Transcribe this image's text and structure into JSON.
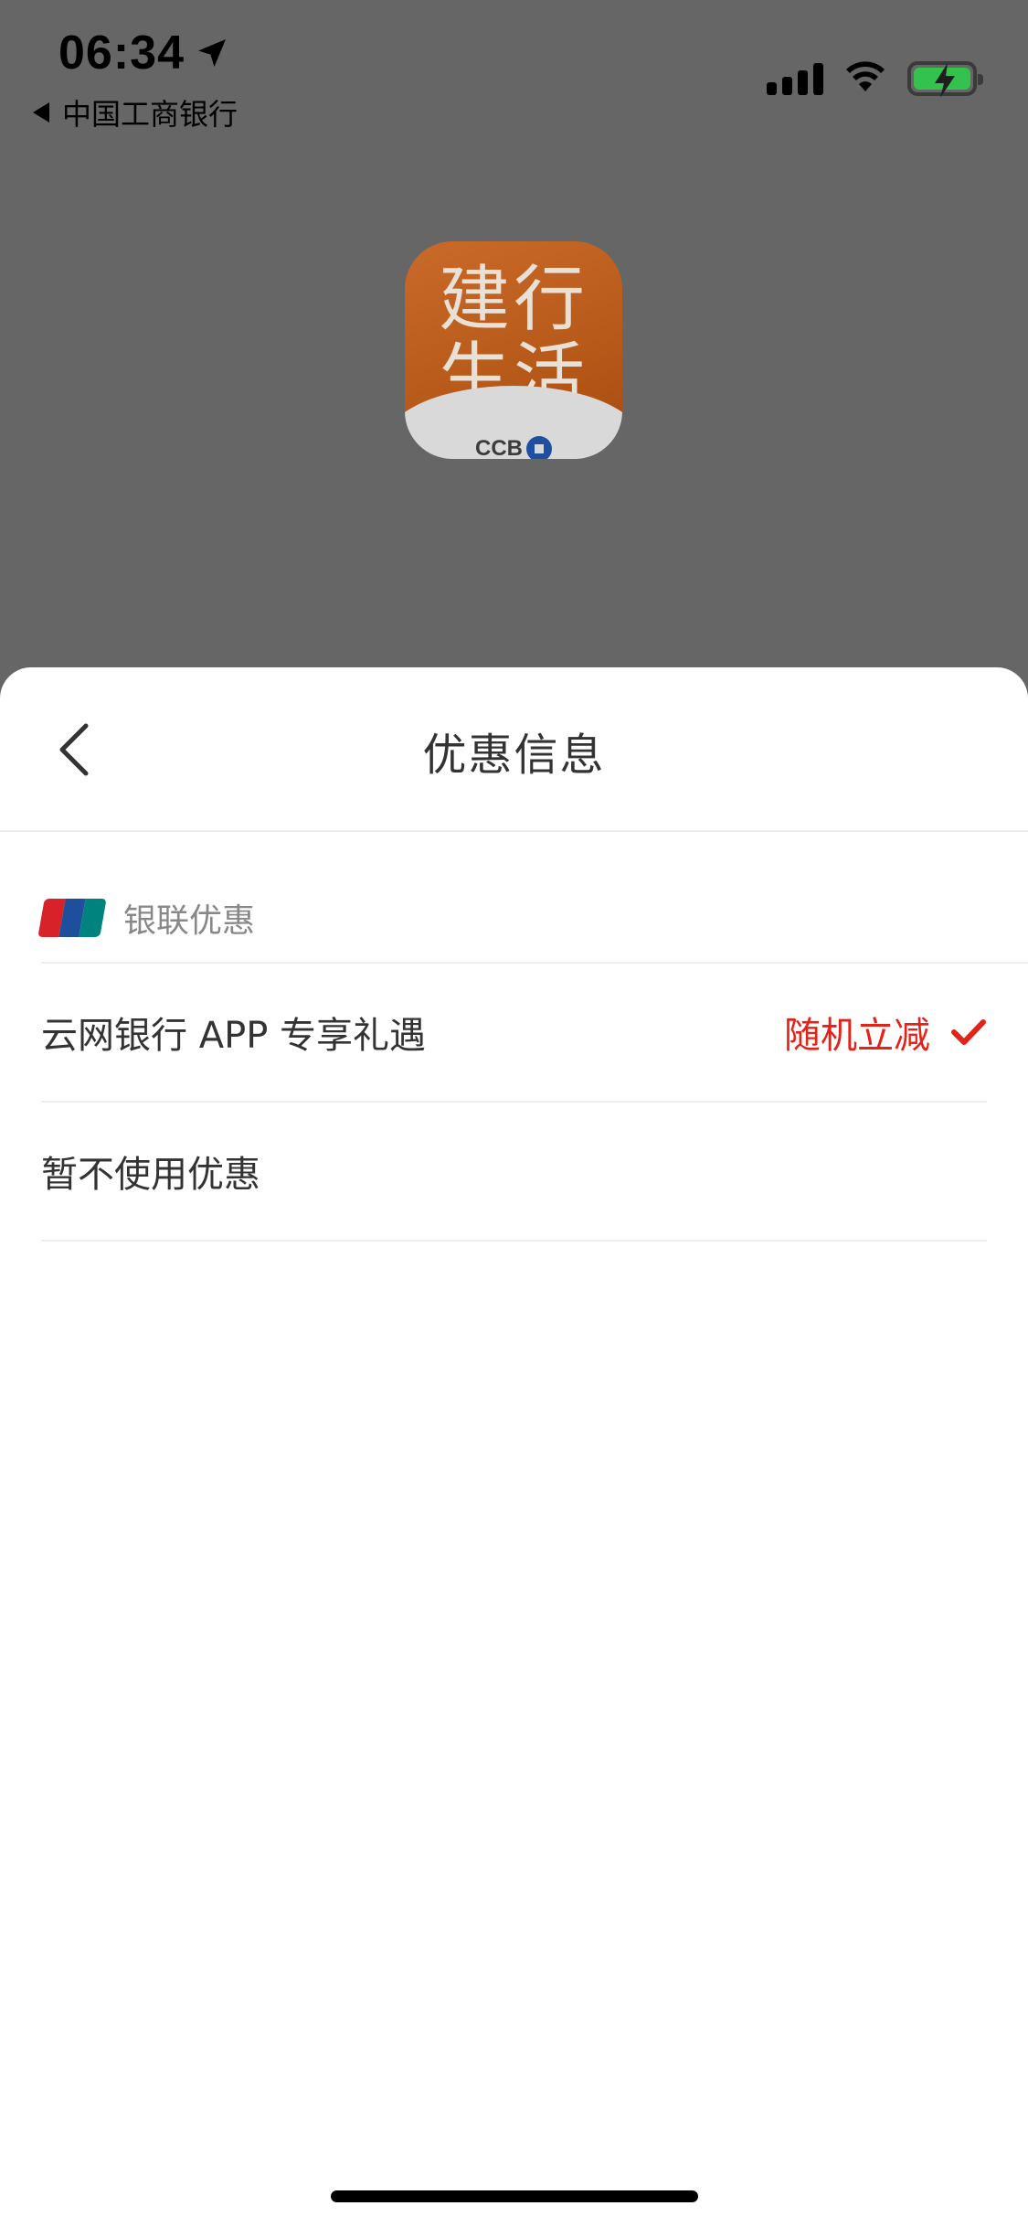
{
  "status_bar": {
    "time": "06:34",
    "back_app_label": "中国工商银行",
    "battery_color": "#33c24d"
  },
  "app_icon": {
    "line1": "建行",
    "line2": "生活",
    "brand": "CCB"
  },
  "sheet": {
    "title": "优惠信息",
    "back_icon": "chevron-left-icon",
    "section": {
      "icon": "unionpay-logo",
      "label": "银联优惠"
    },
    "options": [
      {
        "label": "云网银行 APP 专享礼遇",
        "value": "随机立减",
        "selected": true
      },
      {
        "label": "暂不使用优惠",
        "value": "",
        "selected": false
      }
    ]
  },
  "colors": {
    "accent_red": "#e2231a",
    "overlay": "#666666"
  }
}
